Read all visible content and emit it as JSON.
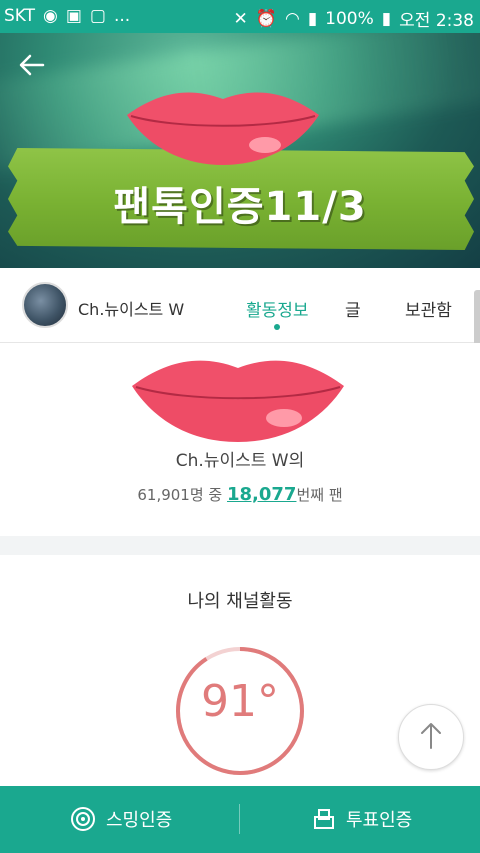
{
  "status_bar": {
    "carrier": "SKT",
    "extra": "...",
    "battery": "100%",
    "time": "오전 2:38"
  },
  "header": {
    "banner_title": "팬톡인증11/3"
  },
  "channel": {
    "name": "Ch.뉴이스트 W",
    "tabs": [
      {
        "label": "활동정보",
        "active": true
      },
      {
        "label": "글",
        "active": false
      },
      {
        "label": "보관함",
        "active": false
      }
    ]
  },
  "profile": {
    "fan_name": "Ch.뉴이스트 W의",
    "total_fans": "61,901명 중",
    "rank": "18,077",
    "rank_suffix": "번째 팬"
  },
  "activity": {
    "title": "나의 채널활동",
    "degree": "91°"
  },
  "bottom_bar": {
    "left_label": "스밍인증",
    "right_label": "투표인증"
  },
  "colors": {
    "accent": "#1aa88f",
    "banner": "#7ab432",
    "gauge": "#e07b7b",
    "lips": "#f0506a"
  }
}
